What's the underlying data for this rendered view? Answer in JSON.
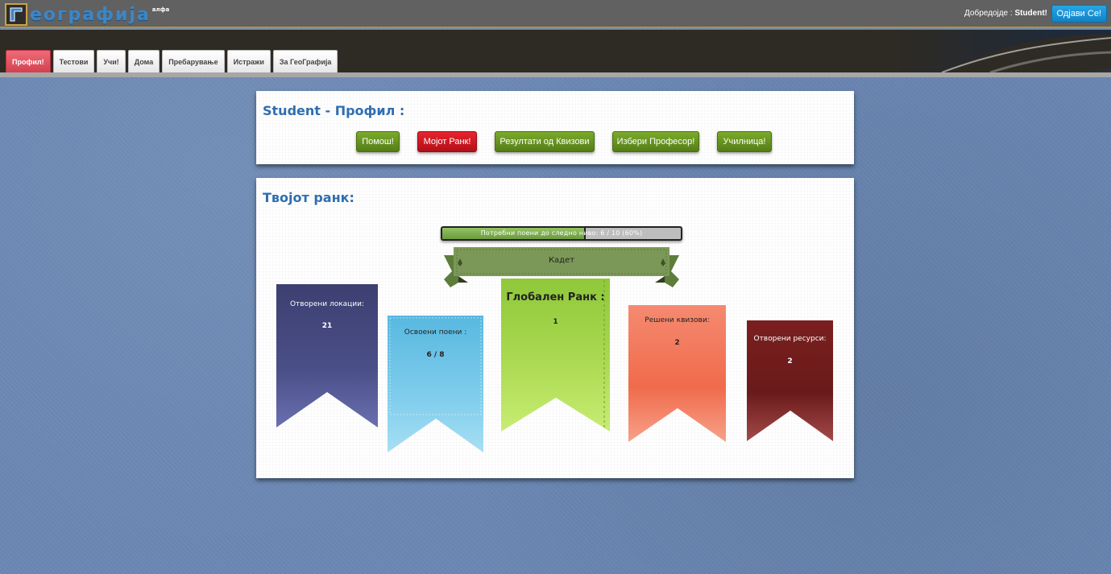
{
  "app": {
    "logo_text": "еографија",
    "logo_badge": "алфа",
    "welcome_prefix": "Добредојде : ",
    "welcome_user": "Student!",
    "logout_label": "Одјави Се!"
  },
  "nav": {
    "tabs": [
      {
        "label": "Профил!",
        "active": true
      },
      {
        "label": "Тестови",
        "active": false
      },
      {
        "label": "Учи!",
        "active": false
      },
      {
        "label": "Дома",
        "active": false
      },
      {
        "label": "Пребарување",
        "active": false
      },
      {
        "label": "Истражи",
        "active": false
      },
      {
        "label": "За ГеоГрафија",
        "active": false
      }
    ]
  },
  "profile": {
    "title": "Student - Профил :",
    "buttons": [
      {
        "label": "Помош!",
        "color": "green"
      },
      {
        "label": "Мојот Ранк!",
        "color": "red"
      },
      {
        "label": "Резултати од Квизови",
        "color": "green"
      },
      {
        "label": "Избери Професор!",
        "color": "green"
      },
      {
        "label": "Училница!",
        "color": "green"
      }
    ]
  },
  "rank": {
    "title": "Твојот ранк:",
    "progress": {
      "text": "Потребни поени до следно ниво: 6 / 10 (60%)",
      "fraction": 0.6
    },
    "level": "Кадет",
    "banners": [
      {
        "label": "Отворени локации:",
        "value": "21",
        "color": "#4a4f86"
      },
      {
        "label": "Освоени поени :",
        "value": "6 / 8",
        "color": "#6fc6e6"
      },
      {
        "label": "Глобален Ранк :",
        "value": "1",
        "color": "#a8d84f"
      },
      {
        "label": "Решени квизови:",
        "value": "2",
        "color": "#f06b4c"
      },
      {
        "label": "Отворени ресурси:",
        "value": "2",
        "color": "#8a2a2a"
      }
    ]
  }
}
